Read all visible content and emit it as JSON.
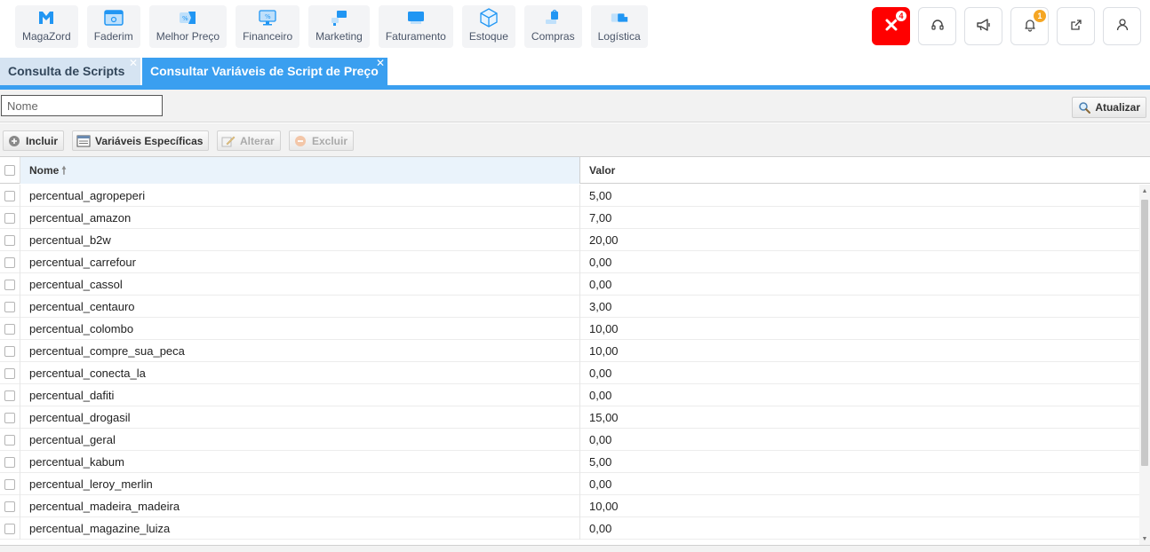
{
  "modules": [
    {
      "id": "magazord",
      "label": "MagaZord",
      "icon": "magazord-logo-icon"
    },
    {
      "id": "faderim",
      "label": "Faderim",
      "icon": "browser-window-icon"
    },
    {
      "id": "melhor-preco",
      "label": "Melhor Preço",
      "icon": "price-tag-icon"
    },
    {
      "id": "financeiro",
      "label": "Financeiro",
      "icon": "monitor-percent-icon"
    },
    {
      "id": "marketing",
      "label": "Marketing",
      "icon": "megaphone-icon"
    },
    {
      "id": "faturamento",
      "label": "Faturamento",
      "icon": "invoice-icon"
    },
    {
      "id": "estoque",
      "label": "Estoque",
      "icon": "box-icon"
    },
    {
      "id": "compras",
      "label": "Compras",
      "icon": "shopping-bag-icon"
    },
    {
      "id": "logistica",
      "label": "Logística",
      "icon": "truck-icon"
    }
  ],
  "top_actions": {
    "close_badge": "4",
    "notifications_badge": "1"
  },
  "tabs": [
    {
      "label": "Consulta de Scripts",
      "active": false
    },
    {
      "label": "Consultar Variáveis de Script de Preço",
      "active": true
    }
  ],
  "filter": {
    "name_placeholder": "Nome",
    "refresh_label": "Atualizar"
  },
  "toolbar": {
    "include_label": "Incluir",
    "specific_vars_label": "Variáveis Específicas",
    "edit_label": "Alterar",
    "delete_label": "Excluir"
  },
  "grid": {
    "columns": [
      "Nome",
      "Valor"
    ],
    "sort_column": "Nome",
    "rows": [
      {
        "nome": "percentual_agropeperi",
        "valor": "5,00"
      },
      {
        "nome": "percentual_amazon",
        "valor": "7,00"
      },
      {
        "nome": "percentual_b2w",
        "valor": "20,00"
      },
      {
        "nome": "percentual_carrefour",
        "valor": "0,00"
      },
      {
        "nome": "percentual_cassol",
        "valor": "0,00"
      },
      {
        "nome": "percentual_centauro",
        "valor": "3,00"
      },
      {
        "nome": "percentual_colombo",
        "valor": "10,00"
      },
      {
        "nome": "percentual_compre_sua_peca",
        "valor": "10,00"
      },
      {
        "nome": "percentual_conecta_la",
        "valor": "0,00"
      },
      {
        "nome": "percentual_dafiti",
        "valor": "0,00"
      },
      {
        "nome": "percentual_drogasil",
        "valor": "15,00"
      },
      {
        "nome": "percentual_geral",
        "valor": "0,00"
      },
      {
        "nome": "percentual_kabum",
        "valor": "5,00"
      },
      {
        "nome": "percentual_leroy_merlin",
        "valor": "0,00"
      },
      {
        "nome": "percentual_madeira_madeira",
        "valor": "10,00"
      },
      {
        "nome": "percentual_magazine_luiza",
        "valor": "0,00"
      }
    ]
  },
  "colors": {
    "accent": "#3a9ff0",
    "module_icon": "#2196f3",
    "danger": "#ff0000"
  }
}
